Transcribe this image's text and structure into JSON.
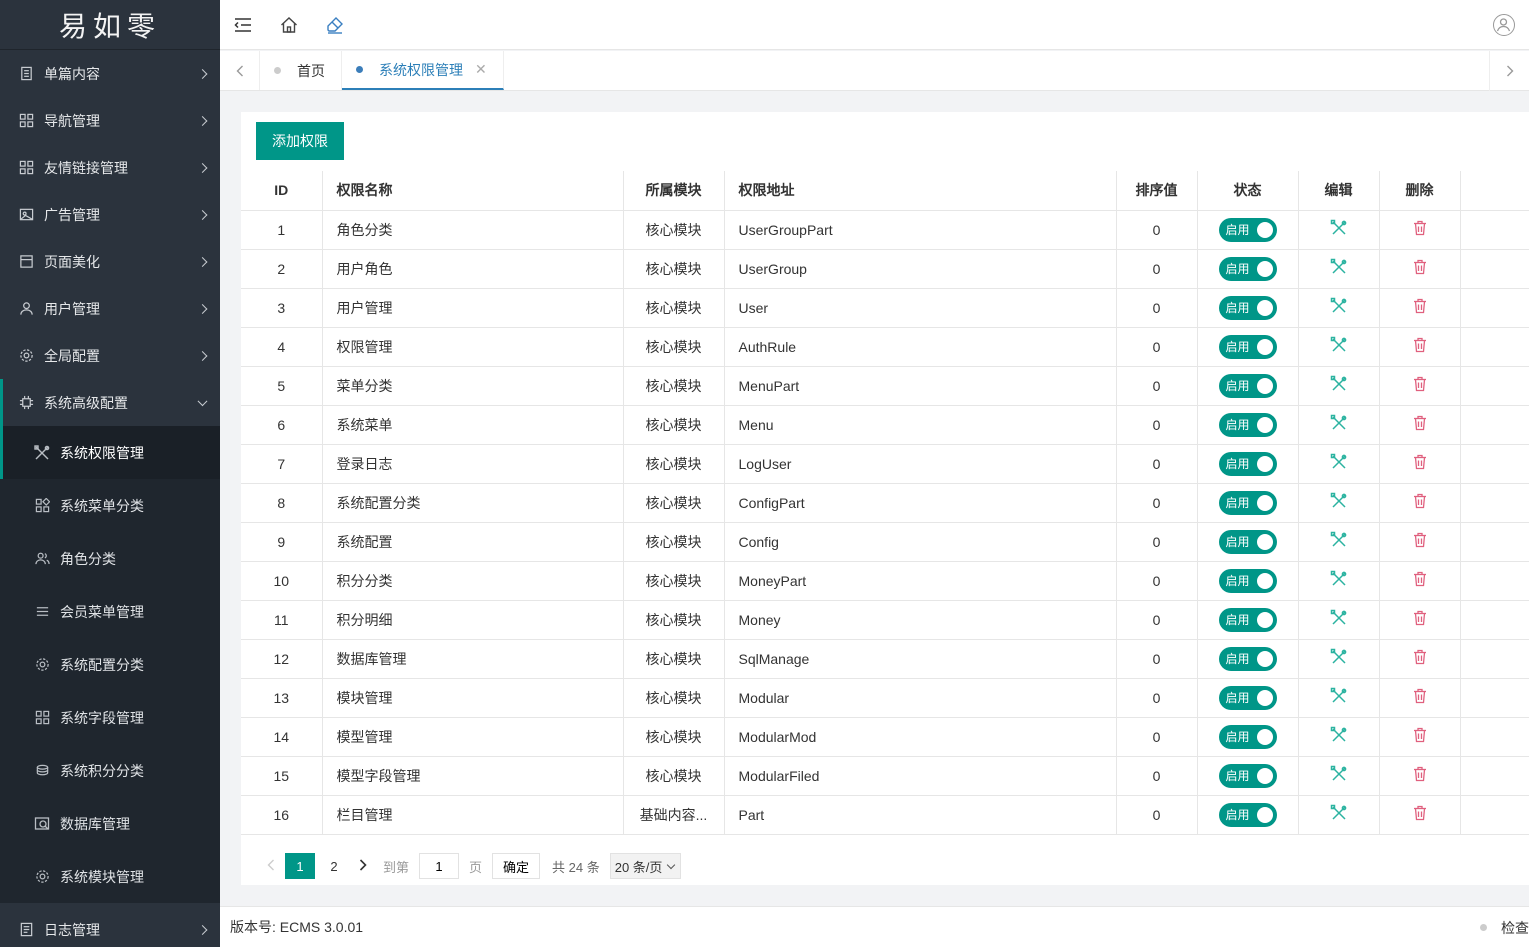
{
  "logo": "易如零",
  "sidebar": {
    "items": [
      {
        "label": "单篇内容",
        "icon": "document-icon"
      },
      {
        "label": "导航管理",
        "icon": "grid-icon"
      },
      {
        "label": "友情链接管理",
        "icon": "grid-icon"
      },
      {
        "label": "广告管理",
        "icon": "image-icon"
      },
      {
        "label": "页面美化",
        "icon": "page-icon"
      },
      {
        "label": "用户管理",
        "icon": "user-icon"
      },
      {
        "label": "全局配置",
        "icon": "gear-icon"
      },
      {
        "label": "系统高级配置",
        "icon": "chip-icon"
      }
    ],
    "subitems": [
      {
        "label": "系统权限管理",
        "icon": "tools-icon"
      },
      {
        "label": "系统菜单分类",
        "icon": "grid-icon"
      },
      {
        "label": "角色分类",
        "icon": "users-icon"
      },
      {
        "label": "会员菜单管理",
        "icon": "list-icon"
      },
      {
        "label": "系统配置分类",
        "icon": "gear-icon"
      },
      {
        "label": "系统字段管理",
        "icon": "grid-icon"
      },
      {
        "label": "系统积分分类",
        "icon": "coins-icon"
      },
      {
        "label": "数据库管理",
        "icon": "database-icon"
      },
      {
        "label": "系统模块管理",
        "icon": "gear-icon"
      }
    ],
    "bottom": {
      "label": "日志管理",
      "icon": "log-icon"
    }
  },
  "tabs": [
    {
      "label": "首页"
    },
    {
      "label": "系统权限管理",
      "close": "✕"
    }
  ],
  "toolbar": {
    "add_label": "添加权限"
  },
  "table": {
    "headers": {
      "id": "ID",
      "name": "权限名称",
      "module": "所属模块",
      "url": "权限地址",
      "sort": "排序值",
      "status": "状态",
      "edit": "编辑",
      "delete": "删除"
    },
    "status_label": "启用",
    "rows": [
      {
        "id": "1",
        "name": "角色分类",
        "module": "核心模块",
        "url": "UserGroupPart",
        "sort": "0"
      },
      {
        "id": "2",
        "name": "用户角色",
        "module": "核心模块",
        "url": "UserGroup",
        "sort": "0"
      },
      {
        "id": "3",
        "name": "用户管理",
        "module": "核心模块",
        "url": "User",
        "sort": "0"
      },
      {
        "id": "4",
        "name": "权限管理",
        "module": "核心模块",
        "url": "AuthRule",
        "sort": "0"
      },
      {
        "id": "5",
        "name": "菜单分类",
        "module": "核心模块",
        "url": "MenuPart",
        "sort": "0"
      },
      {
        "id": "6",
        "name": "系统菜单",
        "module": "核心模块",
        "url": "Menu",
        "sort": "0"
      },
      {
        "id": "7",
        "name": "登录日志",
        "module": "核心模块",
        "url": "LogUser",
        "sort": "0"
      },
      {
        "id": "8",
        "name": "系统配置分类",
        "module": "核心模块",
        "url": "ConfigPart",
        "sort": "0"
      },
      {
        "id": "9",
        "name": "系统配置",
        "module": "核心模块",
        "url": "Config",
        "sort": "0"
      },
      {
        "id": "10",
        "name": "积分分类",
        "module": "核心模块",
        "url": "MoneyPart",
        "sort": "0"
      },
      {
        "id": "11",
        "name": "积分明细",
        "module": "核心模块",
        "url": "Money",
        "sort": "0"
      },
      {
        "id": "12",
        "name": "数据库管理",
        "module": "核心模块",
        "url": "SqlManage",
        "sort": "0"
      },
      {
        "id": "13",
        "name": "模块管理",
        "module": "核心模块",
        "url": "Modular",
        "sort": "0"
      },
      {
        "id": "14",
        "name": "模型管理",
        "module": "核心模块",
        "url": "ModularMod",
        "sort": "0"
      },
      {
        "id": "15",
        "name": "模型字段管理",
        "module": "核心模块",
        "url": "ModularFiled",
        "sort": "0"
      },
      {
        "id": "16",
        "name": "栏目管理",
        "module": "基础内容...",
        "url": "Part",
        "sort": "0"
      }
    ]
  },
  "pager": {
    "pages": [
      "1",
      "2"
    ],
    "goto_label": "到第",
    "page_value": "1",
    "page_suffix": "页",
    "confirm": "确定",
    "total": "共 24 条",
    "per_page": "20 条/页"
  },
  "footer": {
    "version": "版本号: ECMS 3.0.01",
    "right_label": "检查"
  },
  "colors": {
    "accent": "#009688",
    "sidebar": "#2b333d",
    "edit": "#2bb3a0",
    "delete": "#e0607e"
  }
}
